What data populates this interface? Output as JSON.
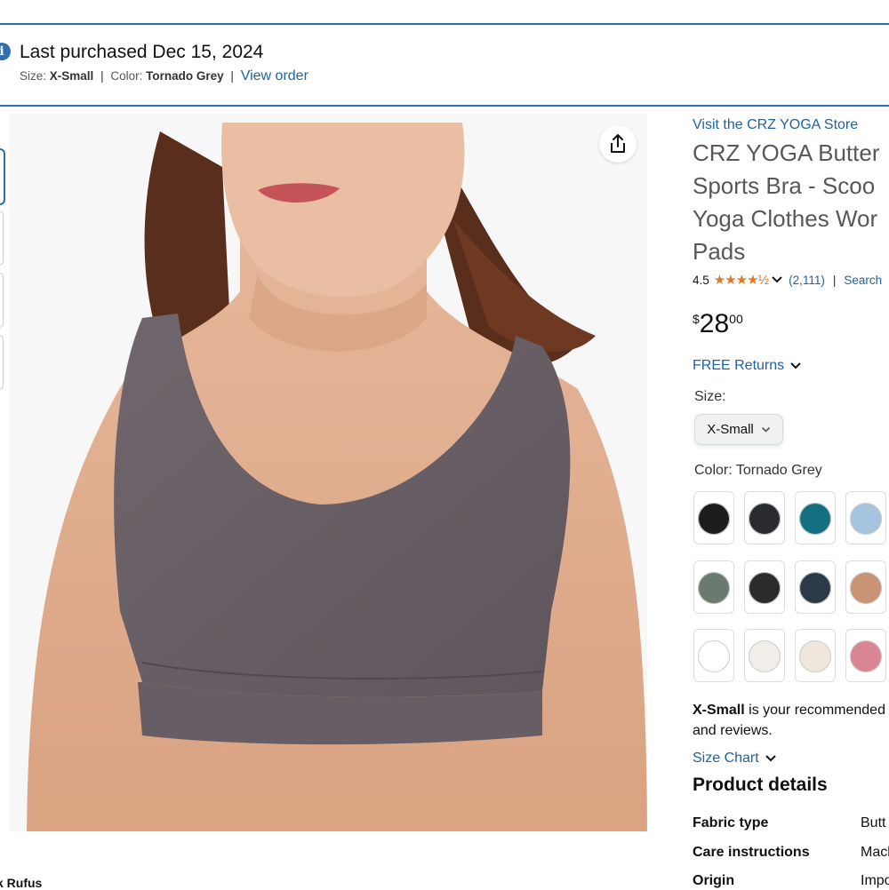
{
  "banner": {
    "title": "Last purchased Dec 15, 2024",
    "size_label": "Size:",
    "size_value": "X-Small",
    "separator": "|",
    "color_label": "Color:",
    "color_value": "Tornado Grey",
    "view_order": "View order",
    "icon": "info-icon"
  },
  "gallery": {
    "share_icon": "share-icon",
    "below_text": "k Rufus"
  },
  "product": {
    "store_link": "Visit the CRZ YOGA Store",
    "title_lines": [
      "CRZ YOGA Butter",
      "Sports Bra - Scoo",
      "Yoga Clothes Wor",
      "Pads"
    ],
    "rating": "4.5",
    "stars": "★★★★½",
    "rating_count": "(2,111)",
    "pipe": "|",
    "search_link": "Search",
    "price_symbol": "$",
    "price_whole": "28",
    "price_fraction": "00",
    "free_returns": "FREE Returns",
    "size_label": "Size:",
    "size_selected": "X-Small",
    "color_label": "Color:",
    "color_value": "Tornado Grey",
    "color_swatches": [
      {
        "color": "#1c1c1e"
      },
      {
        "color": "#2a2b2f"
      },
      {
        "color": "#146f80"
      },
      {
        "color": "#a7c4df"
      },
      {
        "color": "#6b7a6e"
      },
      {
        "color": "#2b2b2d"
      },
      {
        "color": "#2c3a47"
      },
      {
        "color": "#c99375"
      },
      {
        "color": "#ffffff"
      },
      {
        "color": "#f1ede8"
      },
      {
        "color": "#efe7dc"
      },
      {
        "color": "#d98596"
      }
    ],
    "recommendation_bold": "X-Small",
    "recommendation_rest": " is your recommended",
    "recommendation_line2": "and reviews.",
    "size_chart": "Size Chart",
    "details_heading": "Product details",
    "details": [
      {
        "key": "Fabric type",
        "value": "Butt"
      },
      {
        "key": "Care instructions",
        "value": "Mach"
      },
      {
        "key": "Origin",
        "value": "Impo"
      }
    ]
  },
  "colors": {
    "link": "#2162a1",
    "banner_border": "#2c6fb0",
    "star": "#de7921",
    "garment": "#6b6169"
  }
}
